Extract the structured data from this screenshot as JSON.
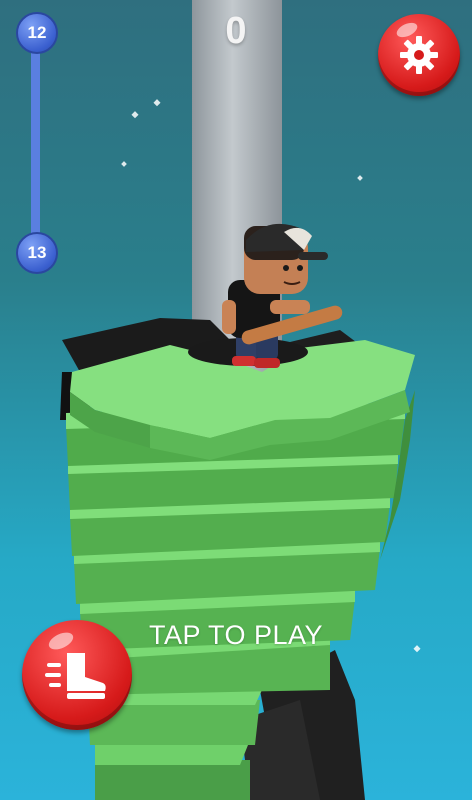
{
  "hud": {
    "score": "0",
    "level_current": "12",
    "level_next": "13",
    "level_progress": 1.0
  },
  "prompt": {
    "tap_to_play": "TAP TO PLAY"
  },
  "buttons": {
    "settings_icon": "gear-icon",
    "kick_icon": "sneaker-kick-icon"
  },
  "colors": {
    "platform_green": "#6fd06a",
    "platform_black": "#1a1a1a",
    "pole": "#a9b0b6",
    "button_red": "#e02424",
    "level_blue": "#3a5fcf",
    "sky_top": "#2f6f7f",
    "sky_bottom": "#2bb3da"
  }
}
